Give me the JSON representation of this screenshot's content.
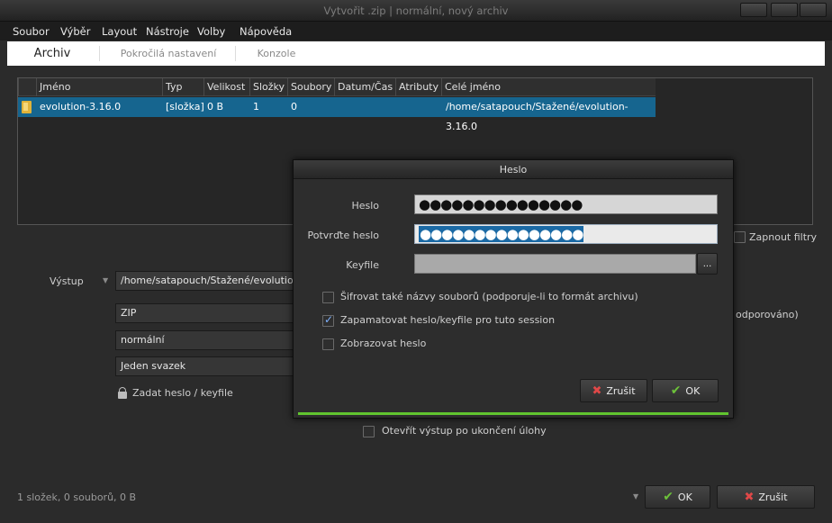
{
  "window": {
    "title": "Vytvořit .zip | normální, nový archiv"
  },
  "menu": [
    "Soubor",
    "Výběr",
    "Layout",
    "Nástroje",
    "Volby",
    "Nápověda"
  ],
  "tabs": [
    {
      "label": "Archiv",
      "active": true
    },
    {
      "label": "Pokročilá nastavení",
      "active": false
    },
    {
      "label": "Konzole",
      "active": false
    }
  ],
  "table": {
    "columns": [
      "Jméno",
      "Typ",
      "Velikost",
      "Složky",
      "Soubory",
      "Datum/Čas",
      "Atributy",
      "Celé jméno"
    ],
    "rows": [
      {
        "name": "evolution-3.16.0",
        "type": "[složka]",
        "size": "0 B",
        "folders": "1",
        "files": "0",
        "datetime": "",
        "attributes": "",
        "fullname": "/home/satapouch/Stažené/evolution-3.16.0"
      }
    ]
  },
  "filters": {
    "label": "Zapnout filtry",
    "checked": false
  },
  "output": {
    "label": "Výstup",
    "path": "/home/satapouch/Stažené/evolution",
    "format": "ZIP",
    "level": "normální",
    "volumes": "Jeden svazek",
    "password_link": "Zadat heslo / keyfile",
    "side_text": "odporováno)"
  },
  "open_after": {
    "label": "Otevřít výstup po ukončení úlohy",
    "checked": false
  },
  "status": "1 složek, 0 souborů, 0 B",
  "main_buttons": {
    "ok": "OK",
    "cancel": "Zrušit"
  },
  "dialog": {
    "title": "Heslo",
    "password_label": "Heslo",
    "password_value": "●●●●●●●●●●●●●●●",
    "confirm_label": "Potvrďte heslo",
    "confirm_value": "●●●●●●●●●●●●●●●",
    "keyfile_label": "Keyfile",
    "keyfile_value": "",
    "browse_label": "...",
    "options": [
      {
        "label": "Šifrovat také názvy souborů (podporuje-li to formát archivu)",
        "checked": false
      },
      {
        "label": "Zapamatovat heslo/keyfile pro tuto session",
        "checked": true
      },
      {
        "label": "Zobrazovat heslo",
        "checked": false
      }
    ],
    "cancel": "Zrušit",
    "ok": "OK"
  },
  "colors": {
    "selection": "#16658f",
    "progress": "#61c42f",
    "ok_icon": "#6dc23a",
    "cancel_icon": "#e04848"
  }
}
